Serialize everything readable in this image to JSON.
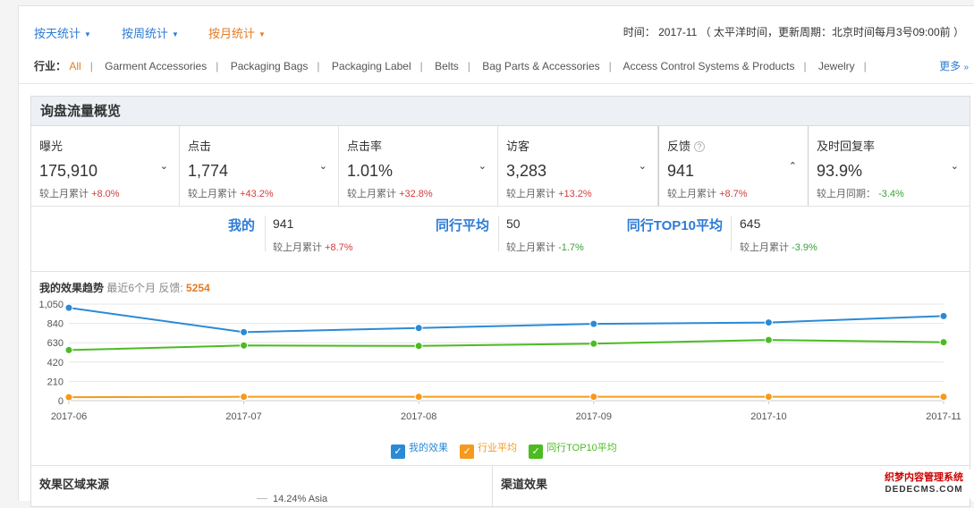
{
  "period_tabs": [
    {
      "label": "按天统计"
    },
    {
      "label": "按周统计"
    },
    {
      "label": "按月统计"
    }
  ],
  "time_info": "时间： 2017-11 （ 太平洋时间，更新周期：北京时间每月3号09:00前 ）",
  "industry": {
    "label": "行业：",
    "items": [
      "All",
      "Garment Accessories",
      "Packaging Bags",
      "Packaging Label",
      "Belts",
      "Bag Parts & Accessories",
      "Access Control Systems & Products",
      "Jewelry"
    ],
    "more": "更多"
  },
  "panel_title": "询盘流量概览",
  "metrics": [
    {
      "name": "曝光",
      "value": "175,910",
      "cmp_label": "较上月累计",
      "cmp_value": "+8.0%"
    },
    {
      "name": "点击",
      "value": "1,774",
      "cmp_label": "较上月累计",
      "cmp_value": "+43.2%"
    },
    {
      "name": "点击率",
      "value": "1.01%",
      "cmp_label": "较上月累计",
      "cmp_value": "+32.8%"
    },
    {
      "name": "访客",
      "value": "3,283",
      "cmp_label": "较上月累计",
      "cmp_value": "+13.2%"
    },
    {
      "name": "反馈",
      "value": "941",
      "cmp_label": "较上月累计",
      "cmp_value": "+8.7%"
    },
    {
      "name": "及时回复率",
      "value": "93.9%",
      "cmp_label": "较上月同期：",
      "cmp_value": "-3.4%"
    }
  ],
  "compare": [
    {
      "title": "我的",
      "value": "941",
      "cmp_label": "较上月累计",
      "cmp_value": "+8.7%"
    },
    {
      "title": "同行平均",
      "value": "50",
      "cmp_label": "较上月累计",
      "cmp_value": "-1.7%"
    },
    {
      "title": "同行TOP10平均",
      "value": "645",
      "cmp_label": "较上月累计",
      "cmp_value": "-3.9%"
    }
  ],
  "trend": {
    "title": "我的效果趋势",
    "subtitle": "最近6个月 反馈:",
    "total": "5254"
  },
  "chart_data": {
    "type": "line",
    "x": [
      "2017-06",
      "2017-07",
      "2017-08",
      "2017-09",
      "2017-10",
      "2017-11"
    ],
    "ylim": [
      0,
      1050
    ],
    "yticks": [
      "0",
      "210",
      "420",
      "630",
      "840",
      "1,050"
    ],
    "series": [
      {
        "name": "我的效果",
        "color": "#2b8ad6",
        "values": [
          1010,
          745,
          790,
          835,
          850,
          920
        ]
      },
      {
        "name": "行业平均",
        "color": "#f59a1c",
        "values": [
          38,
          42,
          42,
          42,
          42,
          42
        ]
      },
      {
        "name": "同行TOP10平均",
        "color": "#4cbb22",
        "values": [
          550,
          600,
          595,
          620,
          660,
          635
        ]
      }
    ]
  },
  "legend": [
    {
      "label": "我的效果",
      "color": "#2b8ad6"
    },
    {
      "label": "行业平均",
      "color": "#f59a1c"
    },
    {
      "label": "同行TOP10平均",
      "color": "#4cbb22"
    }
  ],
  "bottom": {
    "left_title": "效果区域来源",
    "right_title": "渠道效果",
    "pie_label": "14.24%  Asia"
  },
  "watermark": {
    "line1": "织梦内容管理系统",
    "line2": "DEDECMS.COM"
  }
}
